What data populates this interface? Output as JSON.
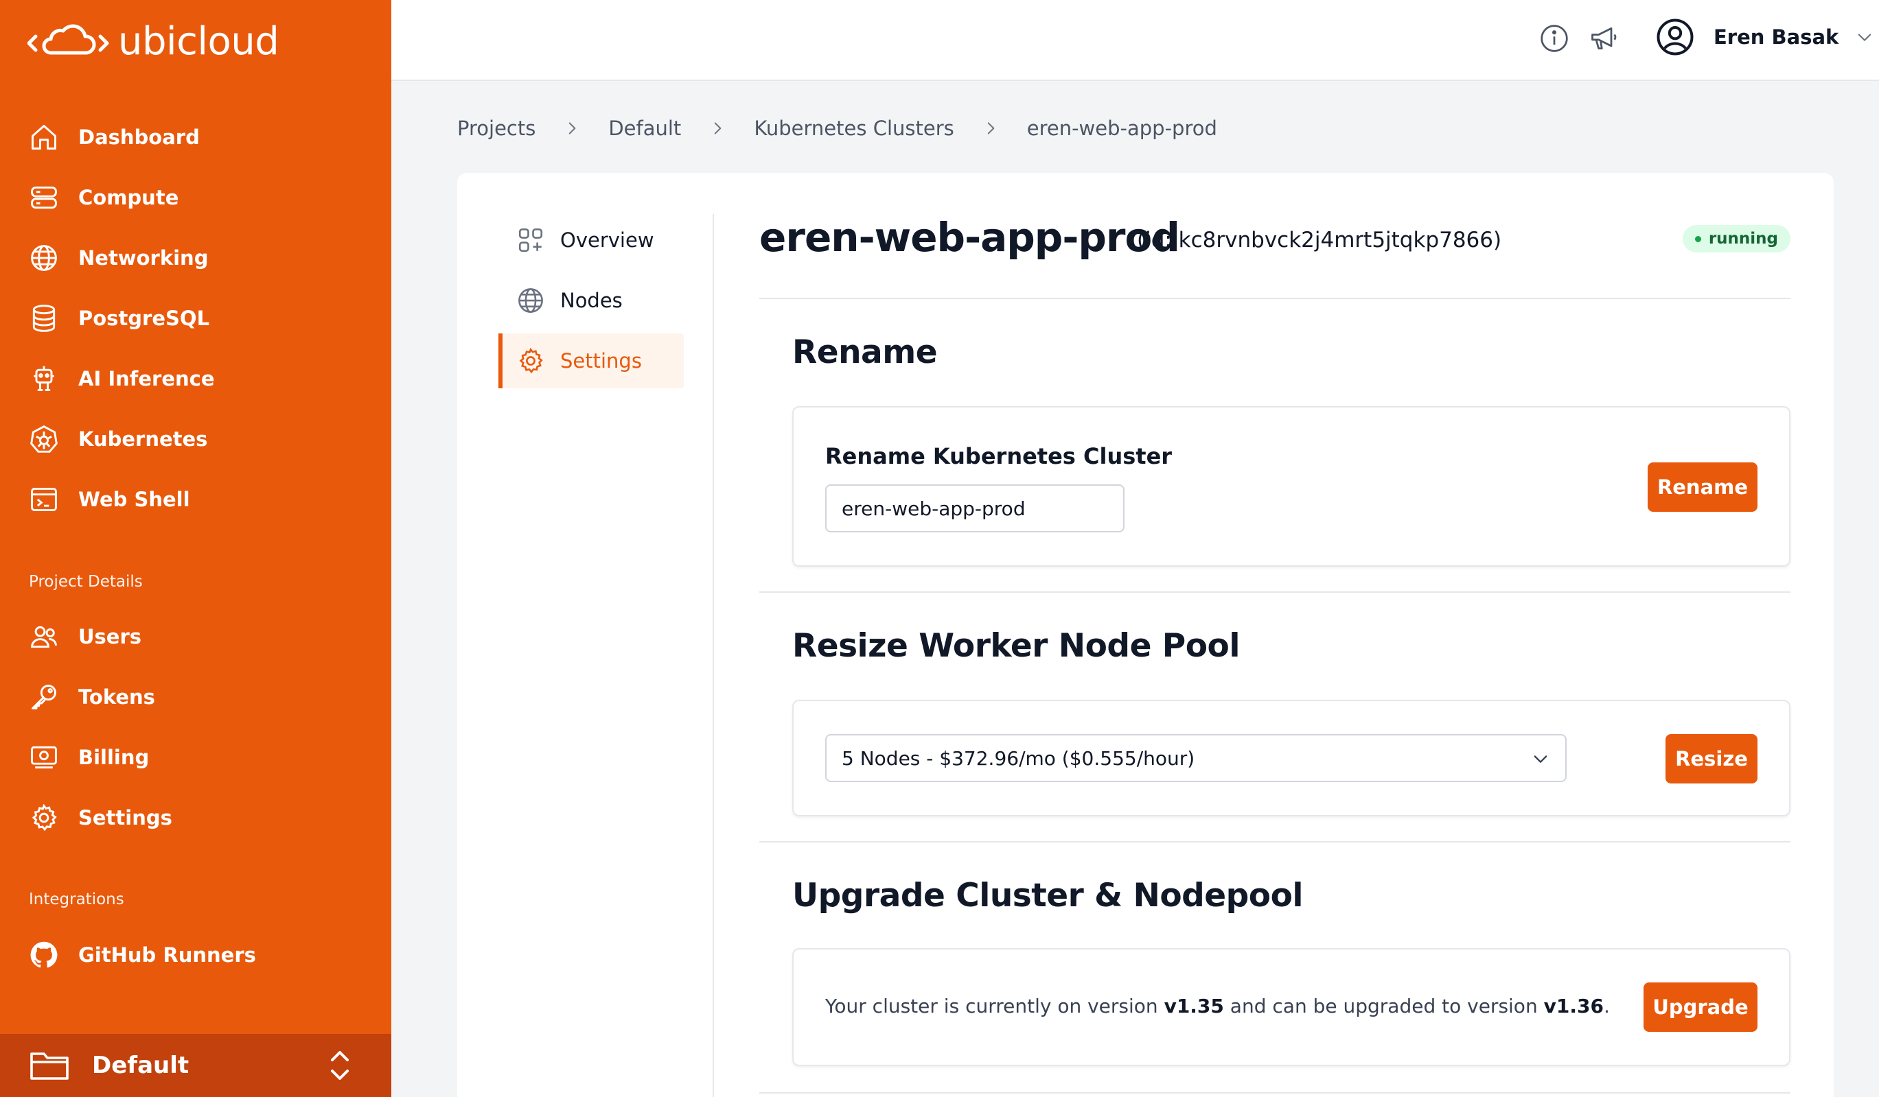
{
  "brand": {
    "name": "ubicloud",
    "color": "#e8590c"
  },
  "sidebar": {
    "main_items": [
      {
        "label": "Dashboard",
        "icon": "home-icon"
      },
      {
        "label": "Compute",
        "icon": "server-icon"
      },
      {
        "label": "Networking",
        "icon": "globe-icon"
      },
      {
        "label": "PostgreSQL",
        "icon": "database-icon"
      },
      {
        "label": "AI Inference",
        "icon": "robot-icon"
      },
      {
        "label": "Kubernetes",
        "icon": "helm-icon"
      },
      {
        "label": "Web Shell",
        "icon": "terminal-icon"
      }
    ],
    "project_section_label": "Project Details",
    "project_items": [
      {
        "label": "Users",
        "icon": "users-icon"
      },
      {
        "label": "Tokens",
        "icon": "key-icon"
      },
      {
        "label": "Billing",
        "icon": "billing-icon"
      },
      {
        "label": "Settings",
        "icon": "gear-icon"
      }
    ],
    "integrations_section_label": "Integrations",
    "integration_items": [
      {
        "label": "GitHub Runners",
        "icon": "github-icon"
      }
    ],
    "current_project": "Default"
  },
  "topbar": {
    "user_name": "Eren Basak"
  },
  "breadcrumb": [
    "Projects",
    "Default",
    "Kubernetes Clusters",
    "eren-web-app-prod"
  ],
  "subnav": [
    {
      "label": "Overview",
      "icon": "overview-icon",
      "active": false
    },
    {
      "label": "Nodes",
      "icon": "globe-icon",
      "active": false
    },
    {
      "label": "Settings",
      "icon": "gear-icon",
      "active": true
    }
  ],
  "cluster": {
    "name": "eren-web-app-prod",
    "id_text": "(id: kc8rvnbvck2j4mrt5jtqkp7866)",
    "status": "running"
  },
  "rename": {
    "title": "Rename",
    "field_label": "Rename Kubernetes Cluster",
    "value": "eren-web-app-prod",
    "button": "Rename"
  },
  "resize": {
    "title": "Resize Worker Node Pool",
    "selected": "5 Nodes - $372.96/mo ($0.555/hour)",
    "button": "Resize"
  },
  "upgrade": {
    "title": "Upgrade Cluster & Nodepool",
    "text_before": "Your cluster is currently on version ",
    "current_version": "v1.35",
    "text_middle": " and can be upgraded to version ",
    "target_version": "v1.36",
    "text_after": ".",
    "button": "Upgrade"
  }
}
